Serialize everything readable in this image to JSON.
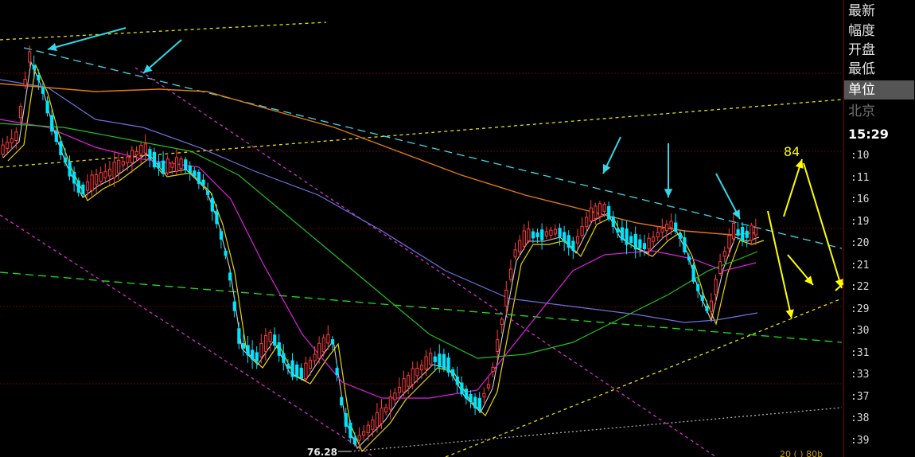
{
  "sidebar": {
    "items": [
      {
        "label": "最新"
      },
      {
        "label": "幅度"
      },
      {
        "label": "开盘"
      },
      {
        "label": "最低"
      },
      {
        "label": "单位"
      },
      {
        "label": "北京"
      }
    ],
    "time": "15:29",
    "ticks": [
      ":10",
      ":11",
      ":16",
      ":19",
      ":20",
      ":21",
      ":22",
      ":29",
      ":30",
      ":31",
      ":33",
      ":37",
      ":38",
      ":39"
    ]
  },
  "chart_data": {
    "type": "line",
    "low_label": "76.28",
    "annotation": "84",
    "bottom_text": "20 ( ) 80b",
    "colors": {
      "up": "#ff3b3b",
      "down": "#00e5ff",
      "ma_white": "#d0d0d0",
      "ma_yellow": "#e8d800",
      "ma_magenta": "#e020e0",
      "ma_green": "#20c020",
      "ma_blue": "#7070e0",
      "ma_orange": "#e07a10",
      "trend_cyan": "#40d8e8",
      "trend_yellow": "#e8e000",
      "trend_green": "#20e020",
      "trend_pink": "#d030d0",
      "arrow_cyan": "#30d8e8",
      "arrow_yellow": "#ffff00"
    }
  }
}
